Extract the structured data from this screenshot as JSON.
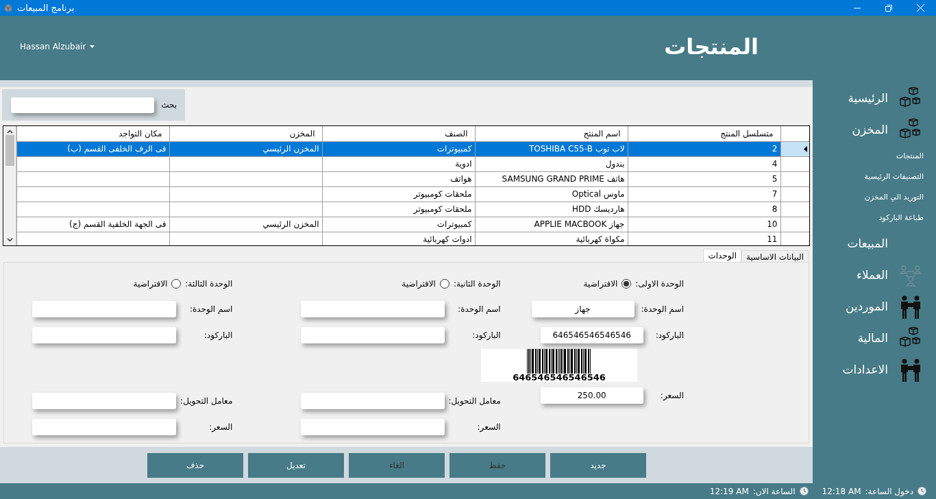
{
  "window": {
    "title": "برنامج المبيعات"
  },
  "header": {
    "user": "Hassan Alzubair",
    "page_title": "المنتجات"
  },
  "sidebar": {
    "items": [
      {
        "label": "الرئيسية",
        "kind": "main"
      },
      {
        "label": "المخزن",
        "kind": "main"
      },
      {
        "label": "المنتجات",
        "kind": "sub"
      },
      {
        "label": "التصنيفات الرئيسية",
        "kind": "sub"
      },
      {
        "label": "التوريد الي المخزن",
        "kind": "sub"
      },
      {
        "label": "طباعة الباركود",
        "kind": "sub"
      },
      {
        "label": "المبيعات",
        "kind": "main"
      },
      {
        "label": "العملاء",
        "kind": "main"
      },
      {
        "label": "الموردين",
        "kind": "main"
      },
      {
        "label": "المالية",
        "kind": "main"
      },
      {
        "label": "الاعدادات",
        "kind": "main"
      }
    ]
  },
  "search": {
    "label": "بحث"
  },
  "table": {
    "columns": [
      "متسلسل المنتج",
      "اسم المنتج",
      "الصنف",
      "المخزن",
      "مكان التواجد"
    ],
    "rows": [
      {
        "selected": true,
        "cells": [
          "2",
          "لاب توب TOSHIBA C55-B",
          "كمبيوترات",
          "المخزن الرئيسي",
          "فى الرف الخلفى القسم (ب)"
        ]
      },
      {
        "selected": false,
        "cells": [
          "4",
          "بندول",
          "ادوية",
          "",
          ""
        ]
      },
      {
        "selected": false,
        "cells": [
          "5",
          "هاتف SAMSUNG GRAND PRIME",
          "هواتف",
          "",
          ""
        ]
      },
      {
        "selected": false,
        "cells": [
          "7",
          "ماوس Optical",
          "ملحقات  كومبيوتر",
          "",
          ""
        ]
      },
      {
        "selected": false,
        "cells": [
          "8",
          "هارديسك HDD",
          "ملحقات  كومبيوتر",
          "",
          ""
        ]
      },
      {
        "selected": false,
        "cells": [
          "10",
          "جهاز APPLIE MACBOOK",
          "كمبيوترات",
          "المخزن الرئيسي",
          "فى الجهة الخلفية القسم (ج)"
        ]
      },
      {
        "selected": false,
        "cells": [
          "11",
          "مكواة كهربائية",
          "ادوات كهربائية",
          "",
          ""
        ]
      }
    ]
  },
  "tabs": [
    {
      "label": "البيانات الاساسية",
      "selected": false
    },
    {
      "label": "الوحدات",
      "selected": true
    }
  ],
  "units": [
    {
      "title": "الوحدة الاولى:",
      "default_label": "الافتراضية",
      "default": true,
      "fields": [
        {
          "kind": "input",
          "label": "اسم الوحدة:",
          "value": "جهاز"
        },
        {
          "kind": "input",
          "label": "الباركود:",
          "value": "646546546546546"
        },
        {
          "kind": "barcode",
          "value": "646546546546546"
        },
        {
          "kind": "input",
          "label": "السعر:",
          "value": "250.00"
        }
      ]
    },
    {
      "title": "الوحدة الثانية:",
      "default_label": "الافتراضية",
      "default": false,
      "fields": [
        {
          "kind": "input",
          "label": "اسم الوحدة:"
        },
        {
          "kind": "input",
          "label": "الباركود:"
        },
        {
          "kind": "input",
          "label": "معامل التحويل:"
        },
        {
          "kind": "input",
          "label": "السعر:"
        }
      ]
    },
    {
      "title": "الوحدة الثالثة:",
      "default_label": "الافتراضية",
      "default": false,
      "fields": [
        {
          "kind": "input",
          "label": "اسم الوحدة:"
        },
        {
          "kind": "input",
          "label": "الباركود:"
        },
        {
          "kind": "input",
          "label": "معامل التحويل:"
        },
        {
          "kind": "input",
          "label": "السعر:"
        }
      ]
    }
  ],
  "buttons": [
    {
      "label": "جديد",
      "disabled": false
    },
    {
      "label": "حفظ",
      "disabled": true
    },
    {
      "label": "الغاء",
      "disabled": true
    },
    {
      "label": "تعديل",
      "disabled": false
    },
    {
      "label": "حذف",
      "disabled": false
    }
  ],
  "status_bar": [
    {
      "label": "دخول الساعة:",
      "time": "12:18 AM"
    },
    {
      "label": "الساعة الان:",
      "time": "12:19 AM"
    }
  ]
}
